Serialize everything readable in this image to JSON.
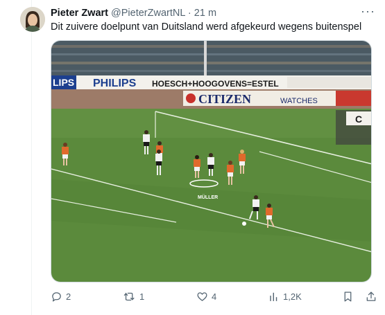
{
  "tweet": {
    "author_name": "Pieter Zwart",
    "handle": "@PieterZwartNL",
    "separator": "·",
    "time": "21 m",
    "more_label": "···",
    "text": "Dit zuivere doelpunt van Duitsland werd afgekeurd wegens buitenspel"
  },
  "media": {
    "billboards": {
      "board1_left": "LIPS",
      "board1_right": "PHILIPS",
      "board2": "HOESCH+HOOGOVENS=ESTEL",
      "board3": "CITIZEN",
      "board3_sub": "WATCHES"
    },
    "player_label": "MÜLLER"
  },
  "actions": {
    "replies": "2",
    "reposts": "1",
    "likes": "4",
    "views": "1,2K"
  },
  "colors": {
    "pitch": "#5b8a3c",
    "text_secondary": "#536471",
    "netherlands_shirt": "#e06a2c",
    "germany_shirt": "#f2f2f2"
  }
}
